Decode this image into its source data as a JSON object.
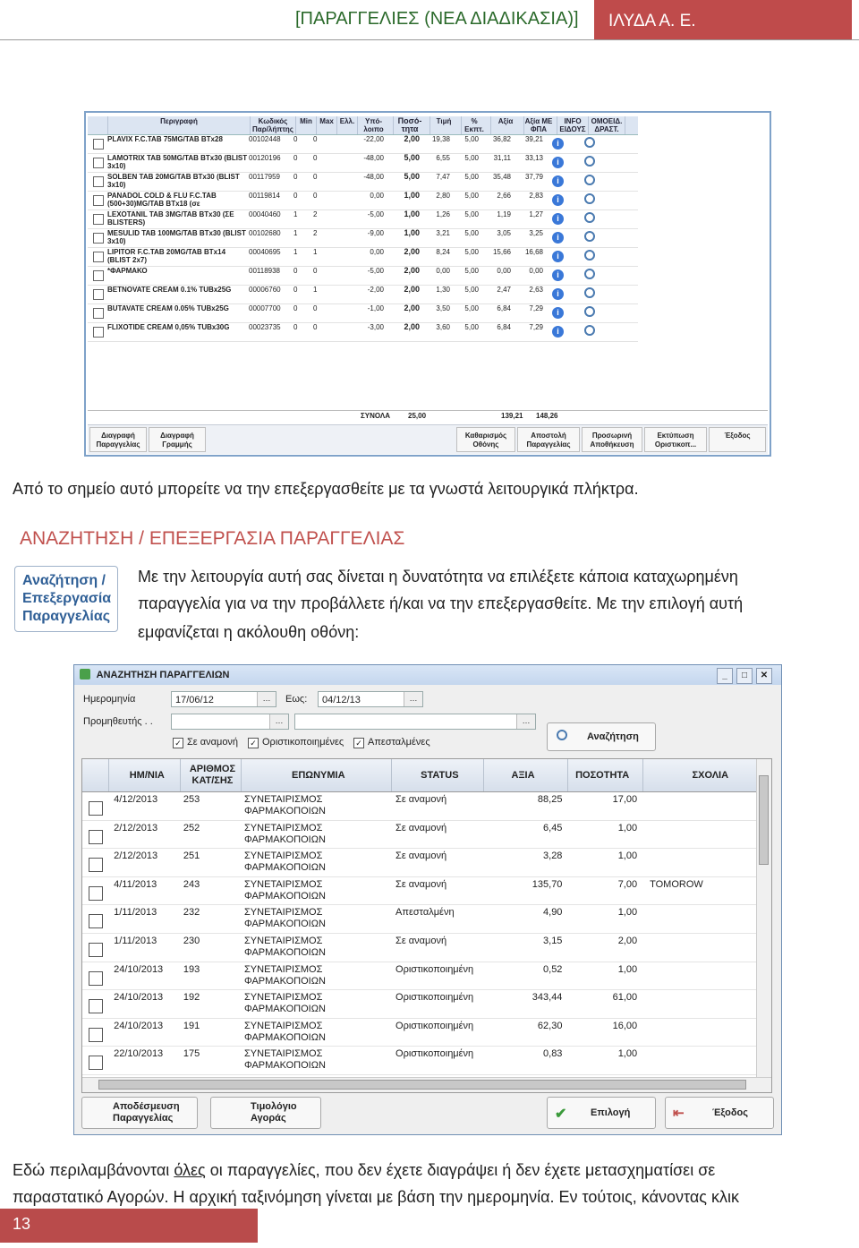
{
  "header": {
    "title": "[ΠΑΡΑΓΓΕΛΙΕΣ (ΝΕΑ ΔΙΑΔΙΚΑΣΙΑ)]",
    "company": "ΙΛΥΔΑ Α. Ε."
  },
  "screenshot1": {
    "columns": [
      "Περιγραφή",
      "Κωδικός Παρ/λήπτης",
      "Min",
      "Max",
      "Ελλ.",
      "Υπό- λοιπο",
      "Ποσό- τητα",
      "Τιμή",
      "% Εκπτ.",
      "Αξία",
      "Αξία ΜΕ ΦΠΑ",
      "INFO ΕΙΔΟΥΣ",
      "ΟΜΟΕΙΔ. ΔΡΑΣΤ."
    ],
    "rows": [
      {
        "desc": "PLAVIX F.C.TAB 75MG/TAB BTx28",
        "code": "00102448",
        "min": "0",
        "max": "0",
        "rem": "-22,00",
        "qty": "2,00",
        "price": "19,38",
        "disc": "5,00",
        "val": "36,82",
        "net": "39,21"
      },
      {
        "desc": "LAMOTRIX TAB 50MG/TAB BTx30 (BLIST 3x10)",
        "code": "00120196",
        "min": "0",
        "max": "0",
        "rem": "-48,00",
        "qty": "5,00",
        "price": "6,55",
        "disc": "5,00",
        "val": "31,11",
        "net": "33,13"
      },
      {
        "desc": "SOLBEN TAB 20MG/TAB BTx30 (BLIST 3x10)",
        "code": "00117959",
        "min": "0",
        "max": "0",
        "rem": "-48,00",
        "qty": "5,00",
        "price": "7,47",
        "disc": "5,00",
        "val": "35,48",
        "net": "37,79"
      },
      {
        "desc": "PANADOL COLD & FLU F.C.TAB (500+30)MG/TAB BTx18 (σε",
        "code": "00119814",
        "min": "0",
        "max": "0",
        "rem": "0,00",
        "qty": "1,00",
        "price": "2,80",
        "disc": "5,00",
        "val": "2,66",
        "net": "2,83"
      },
      {
        "desc": "LEXOTANIL TAB 3MG/TAB BTx30 (ΣΕ BLISTERS)",
        "code": "00040460",
        "min": "1",
        "max": "2",
        "rem": "-5,00",
        "qty": "1,00",
        "price": "1,26",
        "disc": "5,00",
        "val": "1,19",
        "net": "1,27"
      },
      {
        "desc": "MESULID TAB 100MG/TAB BTx30 (BLIST 3x10)",
        "code": "00102680",
        "min": "1",
        "max": "2",
        "rem": "-9,00",
        "qty": "1,00",
        "price": "3,21",
        "disc": "5,00",
        "val": "3,05",
        "net": "3,25"
      },
      {
        "desc": "LIPITOR F.C.TAB 20MG/TAB BTx14 (BLIST 2x7)",
        "code": "00040695",
        "min": "1",
        "max": "1",
        "rem": "0,00",
        "qty": "2,00",
        "price": "8,24",
        "disc": "5,00",
        "val": "15,66",
        "net": "16,68"
      },
      {
        "desc": "*ΦΑΡΜΑΚΟ",
        "code": "00118938",
        "min": "0",
        "max": "0",
        "rem": "-5,00",
        "qty": "2,00",
        "price": "0,00",
        "disc": "5,00",
        "val": "0,00",
        "net": "0,00"
      },
      {
        "desc": "BETNOVATE CREAM 0.1% TUBx25G",
        "code": "00006760",
        "min": "0",
        "max": "1",
        "rem": "-2,00",
        "qty": "2,00",
        "price": "1,30",
        "disc": "5,00",
        "val": "2,47",
        "net": "2,63"
      },
      {
        "desc": "BUTAVATE CREAM 0.05% TUBx25G",
        "code": "00007700",
        "min": "0",
        "max": "0",
        "rem": "-1,00",
        "qty": "2,00",
        "price": "3,50",
        "disc": "5,00",
        "val": "6,84",
        "net": "7,29"
      },
      {
        "desc": "FLIXOTIDE CREAM 0,05% TUBx30G",
        "code": "00023735",
        "min": "0",
        "max": "0",
        "rem": "-3,00",
        "qty": "2,00",
        "price": "3,60",
        "disc": "5,00",
        "val": "6,84",
        "net": "7,29"
      }
    ],
    "totals": {
      "label": "ΣΥΝΟΛΑ",
      "qty": "25,00",
      "val": "139,21",
      "net": "148,26"
    },
    "buttons": {
      "delete_order": "Διαγραφή Παραγγελίας",
      "delete_line": "Διαγραφή Γραμμής",
      "clear_screen": "Καθαρισμός Οθόνης",
      "send_order": "Αποστολή Παραγγελίας",
      "temp_save": "Προσωρινή Αποθήκευση",
      "print_final": "Εκτύπωση Οριστικοπ...",
      "exit": "Έξοδος"
    }
  },
  "text": {
    "line1": "Από το σημείο αυτό μπορείτε να την επεξεργασθείτε με τα γνωστά λειτουργικά πλήκτρα.",
    "section_title": "ΑΝΑΖΗΤΗΣΗ / ΕΠΕΞΕΡΓΑΣΙΑ ΠΑΡΑΓΓΕΛΙΑΣ",
    "side_icon": "Αναζήτηση / Επεξεργασία Παραγγελίας",
    "para_l1": "Με την λειτουργία αυτή σας δίνεται η δυνατότητα να επιλέξετε κάποια καταχωρημένη",
    "para_l2": "παραγγελία για να την προβάλλετε ή/και να την επεξεργασθείτε. Με την επιλογή αυτή",
    "para_l3": "εμφανίζεται η ακόλουθη οθόνη:",
    "bottom_l1_a": "Εδώ περιλαμβάνονται ",
    "bottom_l1_u": "όλες",
    "bottom_l1_b": " οι παραγγελίες, που δεν έχετε διαγράψει ή δεν έχετε μετασχηματίσει σε",
    "bottom_l2": "παραστατικό Αγορών. Η αρχική ταξινόμηση γίνεται με βάση την ημερομηνία. Εν τούτοις, κάνοντας κλικ"
  },
  "screenshot2": {
    "title": "ΑΝΑΖΗΤΗΣΗ ΠΑΡΑΓΓΕΛΙΩΝ",
    "date_label": "Ημερομηνία",
    "date_from": "17/06/12",
    "to_label": "Εως:",
    "date_to": "04/12/13",
    "supplier_label": "Προμηθευτής . .",
    "chk_pending": "Σε αναμονή",
    "chk_final": "Οριστικοποιημένες",
    "chk_sent": "Απεσταλμένες",
    "search_button": "Αναζήτηση",
    "columns": [
      "ΗΜ/ΝΙΑ",
      "ΑΡΙΘΜΟΣ ΚΑΤ/ΣΗΣ",
      "ΕΠΩΝΥΜΙΑ",
      "STATUS",
      "ΑΞΙΑ",
      "ΠΟΣΟΤΗΤΑ",
      "ΣΧΟΛΙΑ"
    ],
    "rows": [
      {
        "date": "4/12/2013",
        "num": "253",
        "name1": "ΣΥΝΕΤΑΙΡΙΣΜΟΣ",
        "name2": "ΦΑΡΜΑΚΟΠΟΙΩΝ",
        "status": "Σε αναμονή",
        "val": "88,25",
        "qty": "17,00",
        "note": ""
      },
      {
        "date": "2/12/2013",
        "num": "252",
        "name1": "ΣΥΝΕΤΑΙΡΙΣΜΟΣ",
        "name2": "ΦΑΡΜΑΚΟΠΟΙΩΝ",
        "status": "Σε αναμονή",
        "val": "6,45",
        "qty": "1,00",
        "note": ""
      },
      {
        "date": "2/12/2013",
        "num": "251",
        "name1": "ΣΥΝΕΤΑΙΡΙΣΜΟΣ",
        "name2": "ΦΑΡΜΑΚΟΠΟΙΩΝ",
        "status": "Σε αναμονή",
        "val": "3,28",
        "qty": "1,00",
        "note": ""
      },
      {
        "date": "4/11/2013",
        "num": "243",
        "name1": "ΣΥΝΕΤΑΙΡΙΣΜΟΣ",
        "name2": "ΦΑΡΜΑΚΟΠΟΙΩΝ",
        "status": "Σε αναμονή",
        "val": "135,70",
        "qty": "7,00",
        "note": "TOMOROW"
      },
      {
        "date": "1/11/2013",
        "num": "232",
        "name1": "ΣΥΝΕΤΑΙΡΙΣΜΟΣ",
        "name2": "ΦΑΡΜΑΚΟΠΟΙΩΝ",
        "status": "Απεσταλμένη",
        "val": "4,90",
        "qty": "1,00",
        "note": ""
      },
      {
        "date": "1/11/2013",
        "num": "230",
        "name1": "ΣΥΝΕΤΑΙΡΙΣΜΟΣ",
        "name2": "ΦΑΡΜΑΚΟΠΟΙΩΝ",
        "status": "Σε αναμονή",
        "val": "3,15",
        "qty": "2,00",
        "note": ""
      },
      {
        "date": "24/10/2013",
        "num": "193",
        "name1": "ΣΥΝΕΤΑΙΡΙΣΜΟΣ",
        "name2": "ΦΑΡΜΑΚΟΠΟΙΩΝ",
        "status": "Οριστικοποιημένη",
        "val": "0,52",
        "qty": "1,00",
        "note": ""
      },
      {
        "date": "24/10/2013",
        "num": "192",
        "name1": "ΣΥΝΕΤΑΙΡΙΣΜΟΣ",
        "name2": "ΦΑΡΜΑΚΟΠΟΙΩΝ",
        "status": "Οριστικοποιημένη",
        "val": "343,44",
        "qty": "61,00",
        "note": ""
      },
      {
        "date": "24/10/2013",
        "num": "191",
        "name1": "ΣΥΝΕΤΑΙΡΙΣΜΟΣ",
        "name2": "ΦΑΡΜΑΚΟΠΟΙΩΝ",
        "status": "Οριστικοποιημένη",
        "val": "62,30",
        "qty": "16,00",
        "note": ""
      },
      {
        "date": "22/10/2013",
        "num": "175",
        "name1": "ΣΥΝΕΤΑΙΡΙΣΜΟΣ",
        "name2": "ΦΑΡΜΑΚΟΠΟΙΩΝ",
        "status": "Οριστικοποιημένη",
        "val": "0,83",
        "qty": "1,00",
        "note": ""
      }
    ],
    "buttons": {
      "save": "Αποδέσμευση Παραγγελίας",
      "invoice": "Τιμολόγιο Αγοράς",
      "select": "Επιλογή",
      "exit": "Έξοδος"
    }
  },
  "footer": {
    "page_number": "13"
  },
  "colors": {
    "accent_red": "#bf4b4b",
    "title_green": "#2b6a2b",
    "section_red": "#c0504d"
  }
}
